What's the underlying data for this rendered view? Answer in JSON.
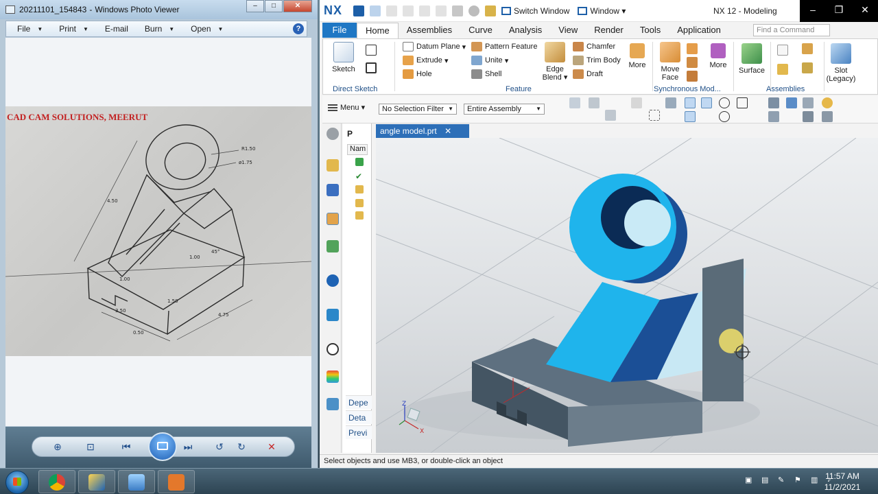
{
  "photo_viewer": {
    "title": "20211101_154843",
    "app_name": "Windows Photo Viewer",
    "menu": [
      "File",
      "Print",
      "E-mail",
      "Burn",
      "Open"
    ],
    "photo_caption": "CAD CAM SOLUTIONS, MEERUT",
    "drawing_dims": [
      "R1.50",
      "ø1.75",
      "4.50",
      "1.00",
      "45°",
      "1.00",
      "1.50",
      "3.50",
      "0.50",
      "4.75"
    ]
  },
  "nx": {
    "logo": "NX",
    "quick_access": {
      "switch_window": "Switch Window",
      "window": "Window"
    },
    "window_title": "NX 12 - Modeling",
    "tabs": [
      "File",
      "Home",
      "Assemblies",
      "Curve",
      "Analysis",
      "View",
      "Render",
      "Tools",
      "Application"
    ],
    "active_tab": "Home",
    "find_placeholder": "Find a Command",
    "ribbon": {
      "sketch": "Sketch",
      "direct_sketch": "Direct Sketch",
      "datum_plane": "Datum Plane",
      "extrude": "Extrude",
      "hole": "Hole",
      "pattern_feature": "Pattern Feature",
      "unite": "Unite",
      "shell": "Shell",
      "edge_blend_1": "Edge",
      "edge_blend_2": "Blend",
      "chamfer": "Chamfer",
      "trim_body": "Trim Body",
      "draft": "Draft",
      "more": "More",
      "feature_group": "Feature",
      "move_face_1": "Move",
      "move_face_2": "Face",
      "sync_more": "More",
      "sync_group": "Synchronous Mod...",
      "surface": "Surface",
      "assemblies_group": "Assemblies",
      "slot_1": "Slot",
      "slot_2": "(Legacy)"
    },
    "menu_label": "Menu",
    "selection_filter": "No Selection Filter",
    "assembly_scope": "Entire Assembly",
    "nav": {
      "header": "P",
      "column": "Nam",
      "sections": [
        "Depe",
        "Deta",
        "Previ"
      ]
    },
    "doc_tab": "angle model.prt",
    "status_text": "Select objects and use MB3, or double-click an object",
    "axis_labels": {
      "x": "X",
      "y": "Y",
      "z": "Z"
    }
  },
  "taskbar": {
    "time": "11:57 AM",
    "date": "11/2/2021"
  },
  "colors": {
    "nx_blue": "#1f77c4",
    "part_cyan": "#1fb4ec",
    "part_dark": "#1b4f96",
    "part_gray": "#516370"
  }
}
